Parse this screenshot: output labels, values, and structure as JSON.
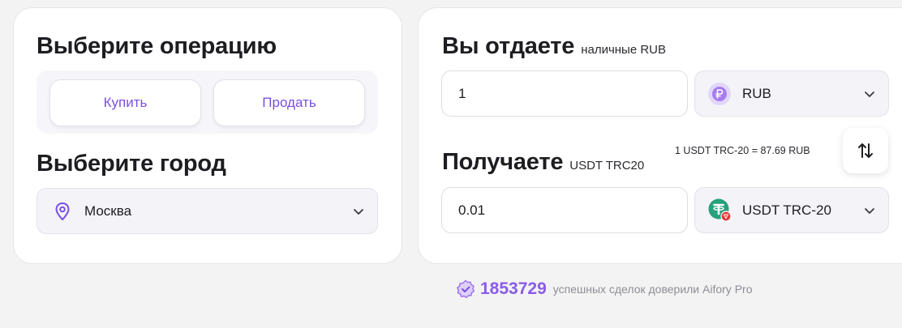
{
  "operation": {
    "title": "Выберите операцию",
    "buy_label": "Купить",
    "sell_label": "Продать"
  },
  "city": {
    "title": "Выберите город",
    "selected": "Москва",
    "icon": "map-pin-icon"
  },
  "give": {
    "title": "Вы отдаете",
    "subtitle": "наличные RUB",
    "amount": "1",
    "currency": "RUB",
    "currency_icon": "ruble-coin-icon"
  },
  "receive": {
    "title": "Получаете",
    "subtitle": "USDT TRC20",
    "amount": "0.01",
    "currency": "USDT TRC-20",
    "currency_icon": "tether-icon"
  },
  "rate": "1 USDT TRC-20 = 87.69 RUB",
  "trust": {
    "count": "1853729",
    "text": "успешных сделок доверили Aifory Pro",
    "icon": "verified-badge-icon"
  },
  "colors": {
    "accent": "#7b4fe0",
    "background": "#f3f3f4",
    "tether": "#26a17b"
  }
}
